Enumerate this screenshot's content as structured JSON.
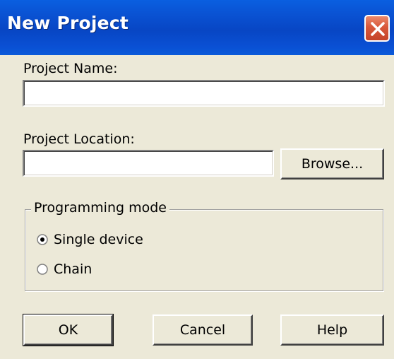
{
  "window": {
    "title": "New Project",
    "close_icon": "close-icon"
  },
  "form": {
    "project_name_label": "Project Name:",
    "project_name_value": "",
    "project_location_label": "Project Location:",
    "project_location_value": "",
    "browse_label": "Browse..."
  },
  "programming_mode": {
    "legend": "Programming mode",
    "options": [
      {
        "label": "Single device",
        "selected": true
      },
      {
        "label": "Chain",
        "selected": false
      }
    ]
  },
  "buttons": {
    "ok": "OK",
    "cancel": "Cancel",
    "help": "Help"
  },
  "colors": {
    "titlebar": "#0846c4",
    "dialog_bg": "#ece9d8",
    "close_button": "#d8573a"
  }
}
